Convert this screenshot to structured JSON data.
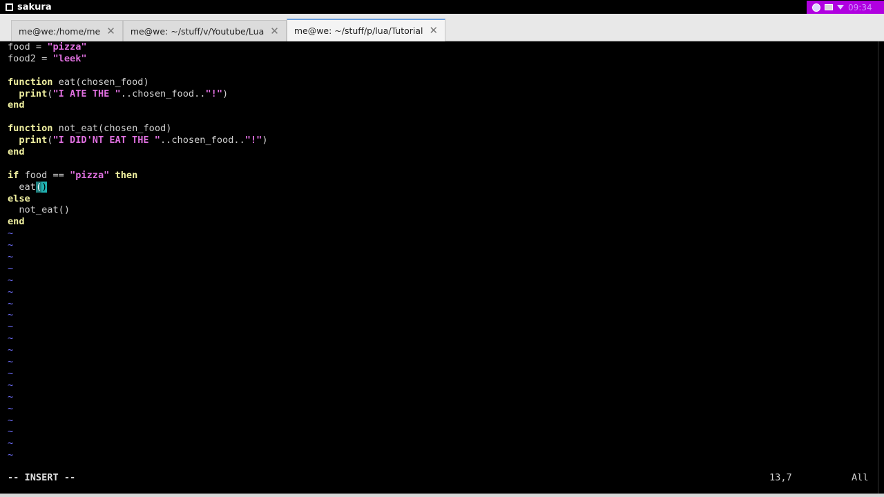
{
  "window": {
    "title": "sakura",
    "clock": "09:34"
  },
  "tabs": [
    {
      "label": "me@we:/home/me",
      "active": false
    },
    {
      "label": "me@we: ~/stuff/v/Youtube/Lua",
      "active": false
    },
    {
      "label": "me@we: ~/stuff/p/lua/Tutorial",
      "active": true
    }
  ],
  "tab_close_glyph": "✕",
  "editor": {
    "lines": [
      "food = \"pizza\"",
      "food2 = \"leek\"",
      "",
      "function eat(chosen_food)",
      "  print(\"I ATE THE \"..chosen_food..\"!\")",
      "end",
      "",
      "function not_eat(chosen_food)",
      "  print(\"I DID'NT EAT THE \"..chosen_food..\"!\")",
      "end",
      "",
      "if food == \"pizza\" then",
      "  eat()",
      "else",
      "  not_eat()",
      "end"
    ],
    "empty_line_marker": "~",
    "empty_line_count": 20
  },
  "status": {
    "mode": "-- INSERT --",
    "position": "13,7",
    "scroll": "All"
  },
  "colors": {
    "keyword": "#f0f0a0",
    "string": "#e070e0",
    "tilde": "#7070ff",
    "tray": "#b000e0"
  },
  "icons": [
    "globe-icon",
    "message-icon",
    "volume-icon"
  ]
}
